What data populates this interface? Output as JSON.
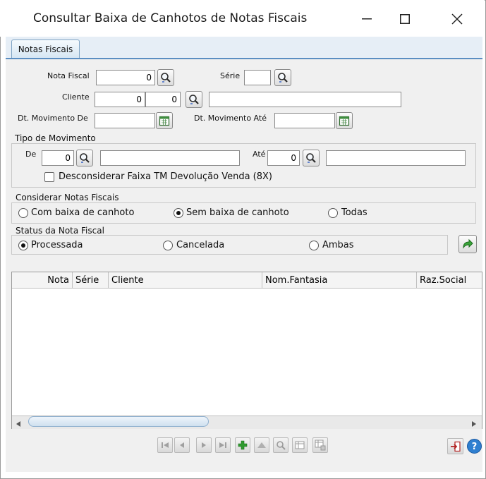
{
  "window": {
    "title": "Consultar Baixa de Canhotos de Notas Fiscais"
  },
  "tabs": [
    {
      "label": "Notas Fiscais"
    }
  ],
  "form": {
    "nota_fiscal": {
      "label": "Nota Fiscal",
      "value": "0"
    },
    "serie": {
      "label": "Série",
      "value": ""
    },
    "cliente": {
      "label": "Cliente",
      "value1": "0",
      "value2": "0",
      "description": ""
    },
    "dt_movimento_de": {
      "label": "Dt. Movimento De",
      "value": ""
    },
    "dt_movimento_ate": {
      "label": "Dt. Movimento Até",
      "value": ""
    }
  },
  "tipo_movimento": {
    "title": "Tipo de Movimento",
    "de": {
      "label": "De",
      "value": "0",
      "description": ""
    },
    "ate": {
      "label": "Até",
      "value": "0",
      "description": ""
    },
    "checkbox_label": "Desconsiderar Faixa TM Devolução Venda (8X)",
    "checkbox_checked": false
  },
  "considerar": {
    "title": "Considerar Notas Fiscais",
    "options": [
      "Com baixa de canhoto",
      "Sem baixa de canhoto",
      "Todas"
    ],
    "selected": "Sem baixa de canhoto"
  },
  "status": {
    "title": "Status da Nota Fiscal",
    "options": [
      "Processada",
      "Cancelada",
      "Ambas"
    ],
    "selected": "Processada"
  },
  "grid": {
    "columns": [
      "Nota",
      "Série",
      "Cliente",
      "Nom.Fantasia",
      "Raz.Social"
    ],
    "rows": []
  },
  "icons": {
    "search": "magnifier-icon",
    "calendar": "calendar-icon",
    "execute": "green-arrow-icon",
    "exit": "exit-door-icon",
    "help": "help-icon"
  }
}
